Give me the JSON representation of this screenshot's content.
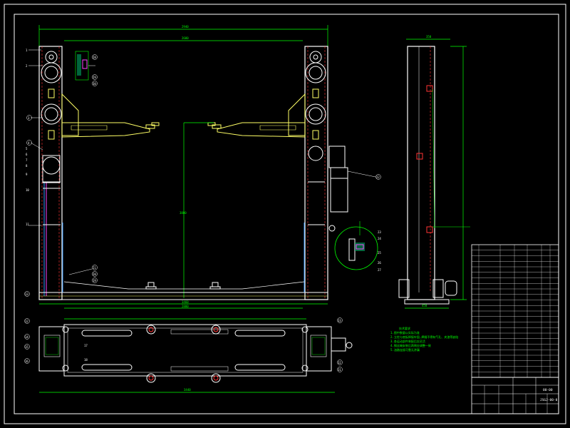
{
  "colors": {
    "background": "#000000",
    "frame": "#ffffff",
    "structure": "#ffffff",
    "dimension": "#00ff00",
    "arm": "#ffff66",
    "hidden_line": "#ff3333",
    "cable": "#3399ff",
    "magenta": "#ff44ff",
    "note_text": "#00ff00",
    "table_text": "#ffffff"
  },
  "callouts": {
    "left": [
      "1",
      "2",
      "3",
      "4",
      "5",
      "6",
      "7",
      "8",
      "9",
      "10",
      "11",
      "13"
    ],
    "upper_detail": [
      "28",
      "29",
      "30"
    ],
    "right": [
      "21",
      "20",
      "19"
    ],
    "motor": [
      "22"
    ],
    "round_detail": [
      "23",
      "24",
      "25",
      "26",
      "27"
    ],
    "plan_left": [
      "12",
      "14",
      "15",
      "16"
    ],
    "plan_inner": [
      "17",
      "18"
    ],
    "plan_right": [
      "33",
      "32",
      "31"
    ]
  },
  "notes": {
    "title": "技术要求",
    "lines": [
      "1.图中数量以实际为准",
      "2.立柱与底板焊接牢固,焊缝不得有气孔、夹渣等缺陷",
      "3.各运动部件装配后应灵活",
      "4.钢丝绳安装后两侧应调整一致",
      "5.油路连接可靠无渗漏"
    ]
  },
  "title_block": {
    "drawing_no": "JSGJ-00-0",
    "short_code": "00-00"
  }
}
